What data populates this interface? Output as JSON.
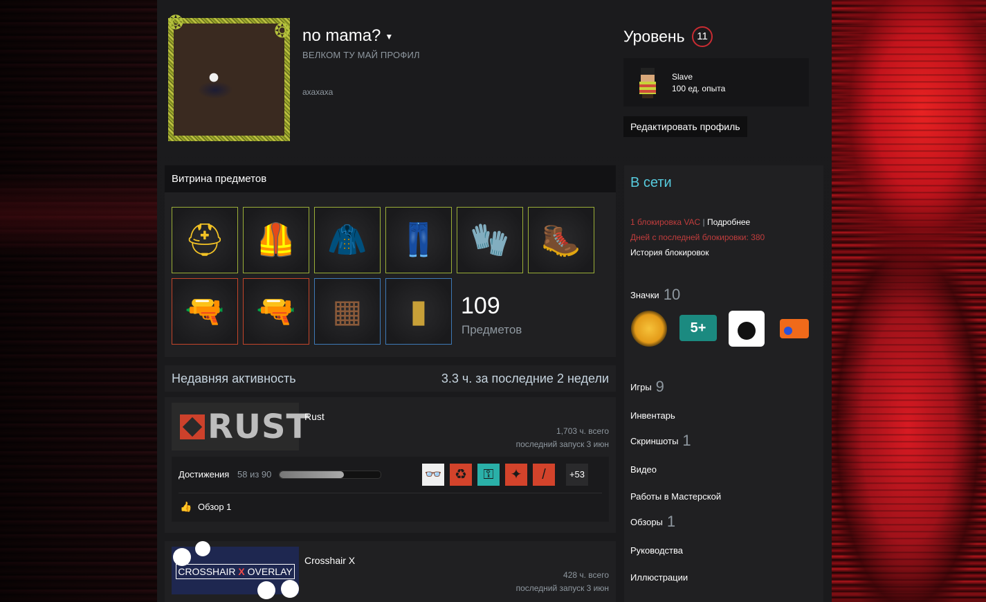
{
  "profile": {
    "name": "no mama?",
    "headline": "ВЕЛКОМ ТУ МАЙ ПРОФИЛ",
    "summary": "ахахаха"
  },
  "level": {
    "label": "Уровень",
    "value": "11"
  },
  "favorite_badge": {
    "name": "Slave",
    "xp": "100 ед. опыта"
  },
  "edit_button": "Редактировать профиль",
  "showcase": {
    "title": "Витрина предметов",
    "count": "109",
    "count_label": "Предметов",
    "items": [
      {
        "name": "helmet-item",
        "glyph": "⛑",
        "color": "#f2c225",
        "rarity": "green"
      },
      {
        "name": "chestplate-item",
        "glyph": "🦺",
        "color": "#e3b52a",
        "rarity": "green"
      },
      {
        "name": "hoodie-item",
        "glyph": "🧥",
        "color": "#3a6ab0",
        "rarity": "green"
      },
      {
        "name": "pants-item",
        "glyph": "👖",
        "color": "#2e5aa8",
        "rarity": "green"
      },
      {
        "name": "gloves-item",
        "glyph": "🧤",
        "color": "#8a3ad0",
        "rarity": "green"
      },
      {
        "name": "boots-item",
        "glyph": "🥾",
        "color": "#c99a3a",
        "rarity": "green"
      },
      {
        "name": "white-rifle-item",
        "glyph": "🔫",
        "color": "#e8e8e8",
        "rarity": "red"
      },
      {
        "name": "graffiti-rifle-item",
        "glyph": "🔫",
        "color": "#e34a9a",
        "rarity": "red"
      },
      {
        "name": "crate-item",
        "glyph": "▦",
        "color": "#8a5a3a",
        "rarity": "blue"
      },
      {
        "name": "door-item",
        "glyph": "▮",
        "color": "#c8a038",
        "rarity": "blue"
      }
    ]
  },
  "activity": {
    "title": "Недавняя активность",
    "hours_num": "3.3",
    "hours_unit": "ч. за последние",
    "weeks_num": "2",
    "weeks_unit": "недели"
  },
  "games": [
    {
      "name": "Rust",
      "total": "1,703 ч. всего",
      "last": "последний запуск 3 июн",
      "logo_text": "RUST",
      "achievements_label": "Достижения",
      "achievements_progress": "58 из 90",
      "achievements_fraction": 0.64,
      "achievements_more": "+53",
      "review": "Обзор 1"
    },
    {
      "name": "Crosshair X",
      "total": "428 ч. всего",
      "last": "последний запуск 3 июн",
      "logo_text_a": "CROSSHAIR",
      "logo_text_x": "X",
      "logo_text_b": "OVERLAY"
    }
  ],
  "sidebar": {
    "status": "В сети",
    "vac_count": "1 блокировка VAC",
    "vac_sep": "|",
    "vac_more": "Подробнее",
    "vac_days": "Дней с последней блокировки: 380",
    "ban_history": "История блокировок",
    "badges_label": "Значки",
    "badges_count": "10",
    "badge2_text": "5+",
    "games_label": "Игры",
    "games_count": "9",
    "inventory": "Инвентарь",
    "screenshots_label": "Скриншоты",
    "screenshots_count": "1",
    "videos": "Видео",
    "workshop": "Работы в Мастерской",
    "reviews_label": "Обзоры",
    "reviews_count": "1",
    "guides": "Руководства",
    "artwork": "Иллюстрации"
  },
  "colors": {
    "online": "#57cbde",
    "vac": "#c23d3d",
    "level_ring": "#c92c32",
    "rust_accent": "#cd412b"
  }
}
